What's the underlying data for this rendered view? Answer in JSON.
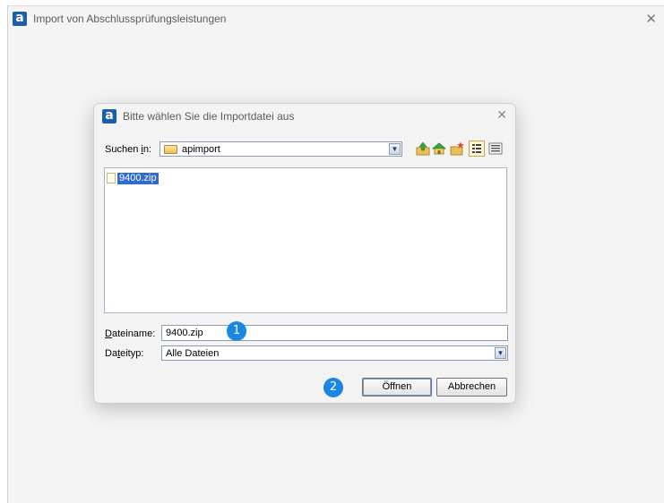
{
  "outer_window": {
    "title": "Import von Abschlussprüfungsleistungen",
    "app_icon_glyph": "a",
    "close_glyph": "✕"
  },
  "dialog": {
    "title": "Bitte wählen Sie die Importdatei aus",
    "close_glyph": "✕",
    "look_in": {
      "label_prefix": "Suchen ",
      "label_accel": "i",
      "label_suffix": "n:",
      "value": "apimport"
    },
    "toolbar": [
      "up-folder-icon",
      "home-icon",
      "new-folder-icon",
      "list-view-icon",
      "details-view-icon"
    ],
    "files": [
      {
        "name": "9400.zip",
        "selected": true
      }
    ],
    "filename": {
      "label_accel": "D",
      "label_rest": "ateiname:",
      "value": "9400.zip"
    },
    "filetype": {
      "label_prefix": "Da",
      "label_accel": "t",
      "label_suffix": "eityp:",
      "value": "Alle Dateien"
    },
    "buttons": {
      "open": "Öffnen",
      "cancel": "Abbrechen"
    },
    "callouts": [
      "1",
      "2"
    ],
    "combo_arrow": "▼"
  },
  "colors": {
    "accent": "#1b86e5",
    "selection": "#2f6bd1",
    "app_icon": "#1b5fa8"
  }
}
